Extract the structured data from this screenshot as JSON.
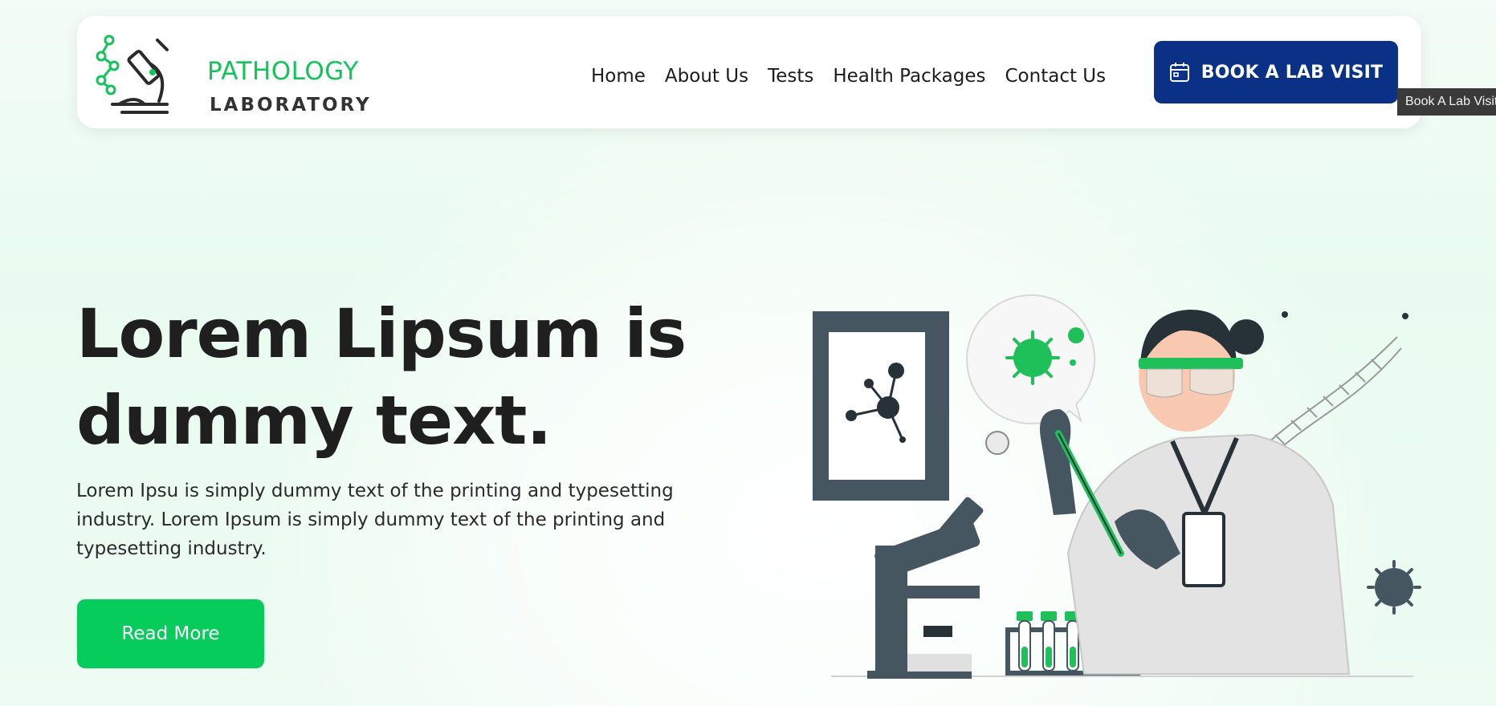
{
  "brand": {
    "name_top": "PATHOLOGY",
    "name_bottom": "LABORATORY",
    "accent_color": "#13c45b",
    "icon": "microscope-logo-icon"
  },
  "nav": {
    "items": [
      {
        "label": "Home"
      },
      {
        "label": "About Us"
      },
      {
        "label": "Tests"
      },
      {
        "label": "Health Packages"
      },
      {
        "label": "Contact Us"
      }
    ]
  },
  "cta": {
    "label": "BOOK A LAB VISIT",
    "icon": "calendar-icon",
    "color": "#0a3185",
    "tooltip": "Book A Lab Visit"
  },
  "hero": {
    "title": "Lorem Lipsum is dummy text.",
    "text": "Lorem Ipsu is simply dummy text of the printing and typesetting industry. Lorem Ipsum is simply dummy text of the printing and typesetting industry.",
    "button_label": "Read More",
    "button_color": "#06cc5b",
    "illustration": "scientist-lab-illustration"
  }
}
